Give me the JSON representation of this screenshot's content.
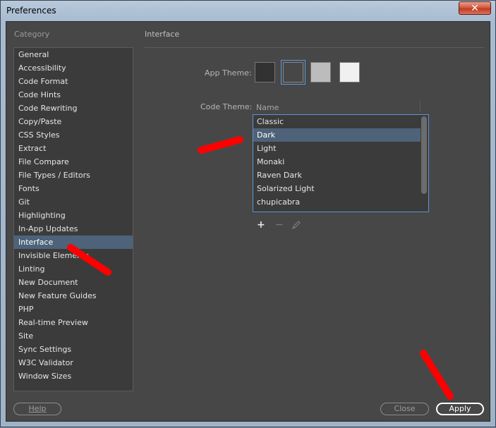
{
  "window": {
    "title": "Preferences",
    "close_glyph": "✕"
  },
  "sidebar": {
    "label": "Category",
    "items": [
      {
        "label": "General"
      },
      {
        "label": "Accessibility"
      },
      {
        "label": "Code Format"
      },
      {
        "label": "Code Hints"
      },
      {
        "label": "Code Rewriting"
      },
      {
        "label": "Copy/Paste"
      },
      {
        "label": "CSS Styles"
      },
      {
        "label": "Extract"
      },
      {
        "label": "File Compare"
      },
      {
        "label": "File Types / Editors"
      },
      {
        "label": "Fonts"
      },
      {
        "label": "Git"
      },
      {
        "label": "Highlighting"
      },
      {
        "label": "In-App Updates"
      },
      {
        "label": "Interface",
        "selected": true
      },
      {
        "label": "Invisible Elements"
      },
      {
        "label": "Linting"
      },
      {
        "label": "New Document"
      },
      {
        "label": "New Feature Guides"
      },
      {
        "label": "PHP"
      },
      {
        "label": "Real-time Preview"
      },
      {
        "label": "Site"
      },
      {
        "label": "Sync Settings"
      },
      {
        "label": "W3C Validator"
      },
      {
        "label": "Window Sizes"
      }
    ]
  },
  "interface": {
    "title": "Interface",
    "app_theme_label": "App Theme:",
    "app_themes": [
      {
        "color": "#323232",
        "selected": false
      },
      {
        "color": "#474747",
        "selected": true
      },
      {
        "color": "#bcbcbc",
        "selected": false
      },
      {
        "color": "#f0f0f0",
        "selected": false
      }
    ],
    "code_theme_label": "Code Theme:",
    "code_theme_header": "Name",
    "code_themes": [
      {
        "label": "Classic"
      },
      {
        "label": "Dark",
        "selected": true
      },
      {
        "label": "Light"
      },
      {
        "label": "Monaki"
      },
      {
        "label": "Raven Dark"
      },
      {
        "label": "Solarized Light"
      },
      {
        "label": "chupicabra"
      }
    ],
    "add_glyph": "+",
    "remove_glyph": "−"
  },
  "footer": {
    "help_label": "Help",
    "close_label": "Close",
    "apply_label": "Apply"
  },
  "colors": {
    "accent": "#5b95d5",
    "selection": "#4e6379",
    "annotation": "#ff0000"
  }
}
